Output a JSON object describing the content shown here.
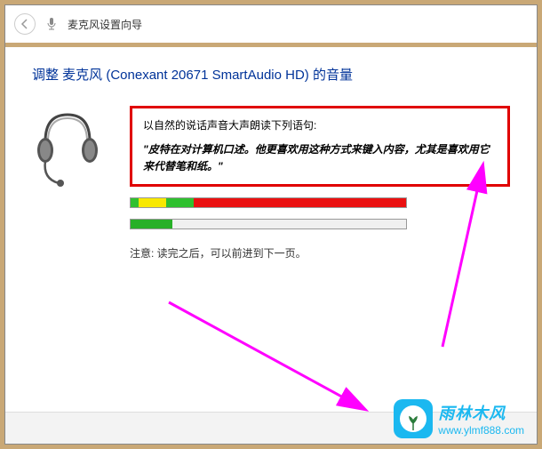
{
  "titlebar": {
    "title": "麦克风设置向导"
  },
  "heading": "调整 麦克风 (Conexant 20671 SmartAudio HD) 的音量",
  "instruction": {
    "label": "以自然的说话声音大声朗读下列语句:",
    "practice": "\"皮特在对计算机口述。他更喜欢用这种方式来键入内容，尤其是喜欢用它来代替笔和纸。\""
  },
  "note": "注意: 读完之后，可以前进到下一页。",
  "watermark": {
    "name": "雨林木风",
    "url": "www.ylmf888.com"
  }
}
